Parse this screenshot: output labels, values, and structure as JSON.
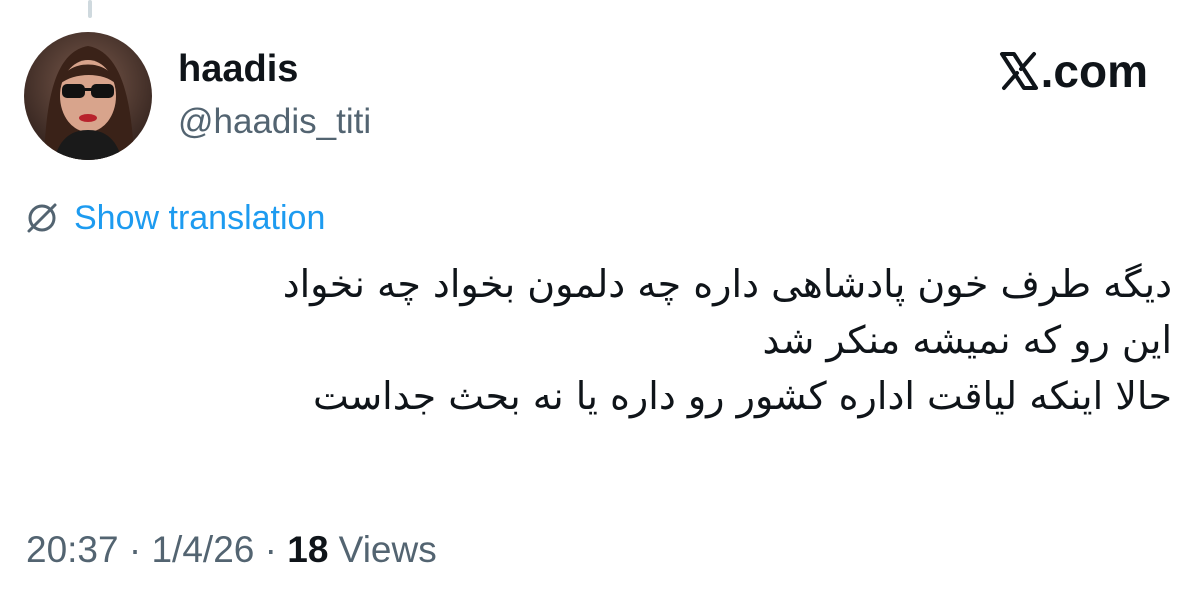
{
  "tweet": {
    "author": {
      "display_name": "haadis",
      "handle": "@haadis_titi",
      "avatar": "profile-photo"
    },
    "brand": {
      "icon": "x-logo-icon",
      "label": ".com"
    },
    "translation": {
      "icon": "globe-translate-icon",
      "label": "Show translation"
    },
    "text_lines": [
      "دیگه طرف خون پادشاهی داره چه دلمون بخواد چه نخواد",
      "این رو که نمیشه منکر شد",
      "حالا اینکه لیاقت اداره کشور رو داره یا نه بحث جداست"
    ],
    "meta": {
      "time": "20:37",
      "separator_1": " · ",
      "date": "1/4/26",
      "separator_2": " · ",
      "views_count": "18",
      "views_label": " Views"
    }
  },
  "colors": {
    "text_primary": "#0f1419",
    "text_secondary": "#536471",
    "link": "#1d9bf0",
    "thread_line": "#cfd9de"
  }
}
